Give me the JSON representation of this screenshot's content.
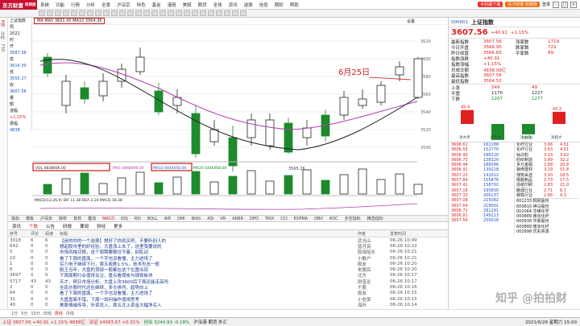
{
  "app": {
    "logo": "东方财富",
    "logo_sub": "经典版"
  },
  "menu": [
    "系统",
    "功能",
    "行情",
    "分析",
    "全景",
    "沪深京",
    "特色",
    "基金",
    "港股",
    "美股",
    "期货",
    "全球",
    "资讯",
    "选股",
    "信息",
    "期权",
    "帮助"
  ],
  "menu_right": {
    "badge": "东方财富 经典版",
    "user": "登录",
    "alert": "手机版下载"
  },
  "info_col": {
    "labels": [
      "上证指数",
      "周",
      "2021",
      "时",
      "开",
      "高",
      "低",
      "收",
      "量",
      "额",
      "涨幅",
      "振幅"
    ],
    "values": [
      "",
      "",
      "",
      "",
      "3587.38",
      "3614.30",
      "3555.27",
      "3607.56",
      "",
      "",
      "+1.15%",
      "4838"
    ]
  },
  "chart": {
    "ma_box": "MA MA5 3601.45 MA10 3564.36",
    "annotation": "6月25日",
    "low_label": "3565.26",
    "y_ticks": [
      "3620",
      "3600",
      "3580",
      "3560",
      "3540",
      "3520",
      "3500"
    ],
    "vol_box1": "VOL 4838606.00",
    "vol_box2": "MA5 4868098.00",
    "vol_box3": "MA10 4444050.00",
    "vol_box4": "MA20 4446468.00",
    "macd_label": "MACD(12,26,9) DIF 11.38 DEA 2.24 MACD 18.28",
    "settings": "设置"
  },
  "chart_tabs": [
    "指标",
    "模板",
    "沪深京",
    "除权",
    "复权",
    "叠加",
    "MACD",
    "KDJ",
    "RSI",
    "BOLL",
    "WR",
    "DMI",
    "BIAS",
    "ASI",
    "VR",
    "ARBR",
    "DPO",
    "TRIX",
    "CCI",
    "EXPMA",
    "OBV",
    "ROC",
    "多空指标",
    "精选指标"
  ],
  "news_tabs": [
    "资讯",
    "个股",
    "公告",
    "研报",
    "要闻",
    "财经",
    "更多"
  ],
  "news_hdr": [
    "序号",
    "评论",
    "阅读",
    "标题",
    "作者",
    "发表时间"
  ],
  "news": [
    {
      "n": "3018",
      "c": "6",
      "t": "【迷的你的一个选择】想好了你就买吧，不要听别人的",
      "a": "武当山",
      "d": "06-26 10:49"
    },
    {
      "n": "642",
      "c": "0",
      "t": "想起股市里的好经验，大盘涨上去了，这里我要说的",
      "a": "蓝月亮",
      "d": "06-26 10:22"
    },
    {
      "n": "5",
      "c": "0",
      "t": "市场风格切换，这个周期要稳住节奏，别乱动",
      "a": "股海船长",
      "d": "06-26 10:21"
    },
    {
      "n": "10",
      "c": "0",
      "t": "看了下周的盘面，一个字也没看懂，主力进场了",
      "a": "小散户",
      "d": "06-26 10:21"
    },
    {
      "n": "1",
      "c": "0",
      "t": "实力电子继续下行，周五收跌1.5%，技术形态一般",
      "a": "股友",
      "d": "06-26 10:20"
    },
    {
      "n": "6",
      "c": "0",
      "t": "股王当年，大盘的顶部一般都在这个位置出现",
      "a": "老股民",
      "d": "06-26 10:20"
    },
    {
      "n": "3697",
      "c": "0",
      "t": "下周周期行业值得关注，重点看煤炭与钢铁板块",
      "a": "北方",
      "d": "06-26 10:17"
    },
    {
      "n": "5717",
      "c": "43",
      "t": "天才，明日市场分析，大盘上攻3600后下周还能走高吗",
      "a": "财富论",
      "d": "06-26 10:17"
    },
    {
      "n": "2",
      "c": "0",
      "t": "全民炒股时代还在继续，多头排列，趋势向上",
      "a": "千股",
      "d": "06-26 10:16"
    },
    {
      "n": "64",
      "c": "0",
      "t": "看了下周的盘面，一个字也没看懂，主力进场了",
      "a": "股友",
      "d": "06-26 10:15"
    },
    {
      "n": "31",
      "c": "0",
      "t": "大盘盘面不错，下周一如何操作值得思考",
      "a": "小韭菜",
      "d": "06-26 10:15"
    },
    {
      "n": "40",
      "c": "0",
      "t": "美股情绪传导，外资流入，周五北上资金大幅净买入",
      "a": "海外",
      "d": "06-26 10:14"
    }
  ],
  "right_panel": {
    "title": "上证指数",
    "code": "000001",
    "price": "3607.56",
    "change": "+40.91",
    "pct": "+1.15%",
    "rows": [
      [
        "最新指数",
        "3607.56",
        "涨家数",
        "1719"
      ],
      [
        "今日开盘",
        "3566.95",
        "跌家数",
        "722"
      ],
      [
        "昨日收盘",
        "3566.65",
        "平家数",
        "89"
      ],
      [
        "指数涨跌",
        "+40.91",
        "",
        ""
      ],
      [
        "指数涨幅",
        "+1.15%",
        "",
        ""
      ],
      [
        "总成交额",
        "4838.99亿",
        "",
        ""
      ],
      [
        "最高指数",
        "3607.56",
        "",
        ""
      ],
      [
        "最低指数",
        "3564.52",
        "",
        ""
      ]
    ],
    "up_down": [
      [
        "上涨",
        "549",
        "49"
      ],
      [
        "平盘",
        "1170",
        "1227"
      ],
      [
        "下跌",
        "1207",
        "1277"
      ]
    ],
    "bars": [
      {
        "v": "49.4",
        "d": "up"
      },
      {
        "v": "-56.7",
        "d": "down"
      },
      {
        "v": "-36.8",
        "d": "down"
      },
      {
        "v": "43.2",
        "d": "up"
      }
    ],
    "bar_labels": [
      "净大单",
      "净中单",
      "净小单",
      "净超大"
    ],
    "ticks": [
      [
        "3606.61",
        "161188"
      ],
      [
        "3606.55",
        "152770"
      ],
      [
        "3606.90",
        "186220"
      ],
      [
        "3606.73",
        "138320"
      ],
      [
        "3606.94",
        "188346"
      ],
      [
        "3606.91",
        "139218"
      ],
      [
        "3607.23",
        "142012"
      ],
      [
        "3607.84",
        "155876"
      ],
      [
        "3607.41",
        "158702"
      ],
      [
        "3607.16",
        "195830"
      ],
      [
        "3607.33",
        "206137"
      ],
      [
        "3607.08",
        "225082"
      ],
      [
        "3607.64",
        "218001"
      ],
      [
        "3606.72",
        "281291"
      ],
      [
        "3606.81",
        "149113"
      ],
      [
        "3607.56",
        "250018"
      ]
    ],
    "sectors": [
      [
        "化纤行业",
        "3.66",
        "4.51"
      ],
      [
        "化纤行业",
        "3.63",
        "4.51"
      ],
      [
        "钛白粉",
        "3.33",
        "3.62"
      ],
      [
        "纺织制造",
        "3.89",
        "32.2"
      ],
      [
        "多元金融",
        "3.68",
        "20.8"
      ],
      [
        "装修建材",
        "3.19",
        "51.8"
      ],
      [
        "煤炭采选",
        "3.10",
        "18.5"
      ],
      [
        "橡胶制品",
        "2.73",
        "17.5"
      ],
      [
        "造纸印刷",
        "2.83",
        "21.0"
      ],
      [
        "酿酒行业",
        "2.71",
        "6.7"
      ],
      [
        "钢铁行业",
        "2.66",
        "4.3"
      ]
    ],
    "stocks": [
      "601233 桐昆股份",
      "600810 神马股份",
      "002064 华峰化学",
      "000889 南京化纤",
      "000938 中鼎股份",
      "600889 南京化纤",
      "002998 优彩资源"
    ]
  },
  "status": {
    "idx1": "上证 3607.56 +40.91 +1.15% 4838亿",
    "idx2": "深证 14583.67 +0.31%",
    "idx3": "创业 3244.93 -0.18%",
    "ticker": "沪深港 期货 外汇",
    "time": "2021/6/26 星期六 15:00"
  }
}
